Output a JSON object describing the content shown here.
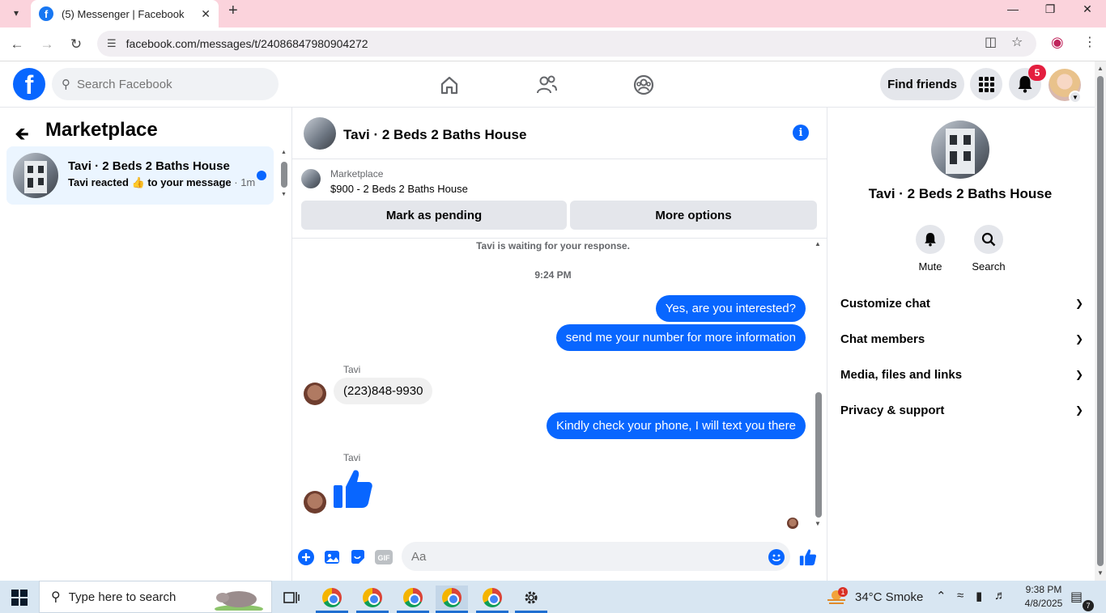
{
  "browser": {
    "tab_title": "(5) Messenger | Facebook",
    "url": "facebook.com/messages/t/24086847980904272"
  },
  "fb_header": {
    "search_placeholder": "Search Facebook",
    "find_friends_label": "Find friends",
    "notification_count": "5"
  },
  "left": {
    "title": "Marketplace",
    "conversation": {
      "name": "Tavi · 2 Beds 2 Baths House",
      "snippet": "Tavi reacted 👍 to your message",
      "time": " · 1m"
    }
  },
  "chat": {
    "header_name": "Tavi · 2 Beds 2 Baths House",
    "listing": {
      "kind": "Marketplace",
      "price_title": "$900 - 2 Beds 2 Baths House",
      "mark_pending_label": "Mark as pending",
      "more_options_label": "More options"
    },
    "waiting_note": "Tavi is waiting for your response.",
    "timestamp": "9:24 PM",
    "messages": [
      {
        "from": "me",
        "text": "Yes, are you interested?"
      },
      {
        "from": "me",
        "text": "send me your number for more information"
      },
      {
        "from": "Tavi",
        "sender_label": "Tavi",
        "text": "(223)848-9930"
      },
      {
        "from": "me",
        "text": "Kindly check your phone, I will text you there"
      },
      {
        "from": "Tavi",
        "sender_label": "Tavi",
        "text": "👍"
      }
    ],
    "composer_placeholder": "Aa"
  },
  "right": {
    "name": "Tavi · 2 Beds 2 Baths House",
    "actions": [
      {
        "label": "Mute",
        "icon": "bell-icon"
      },
      {
        "label": "Search",
        "icon": "search-icon"
      }
    ],
    "sections": [
      "Customize chat",
      "Chat members",
      "Media, files and links",
      "Privacy & support"
    ]
  },
  "taskbar": {
    "search_placeholder": "Type here to search",
    "weather": "34°C  Smoke",
    "weather_badge": "1",
    "time": "9:38 PM",
    "date": "4/8/2025",
    "notification_badge": "7"
  },
  "colors": {
    "accent": "#0866ff",
    "tab_bar": "#fbd3dc",
    "taskbar": "#d8e6f2"
  }
}
